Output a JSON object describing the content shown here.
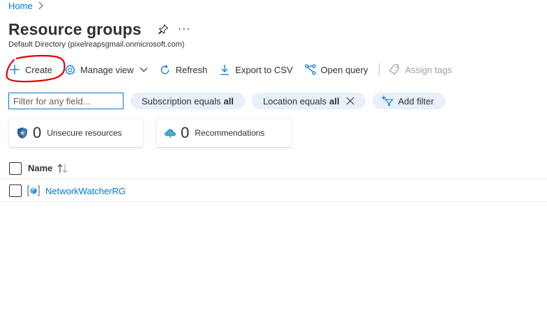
{
  "breadcrumb": {
    "home": "Home"
  },
  "header": {
    "title": "Resource groups",
    "subtitle": "Default Directory (pixelreapsgmail.onmicrosoft.com)",
    "more": "···"
  },
  "toolbar": {
    "create": "Create",
    "manage_view": "Manage view",
    "refresh": "Refresh",
    "export_csv": "Export to CSV",
    "open_query": "Open query",
    "assign_tags": "Assign tags"
  },
  "filters": {
    "placeholder": "Filter for any field...",
    "subscription_label": "Subscription equals",
    "subscription_value": "all",
    "location_label": "Location equals",
    "location_value": "all",
    "add_filter": "Add filter"
  },
  "cards": [
    {
      "count": "0",
      "label": "Unsecure resources",
      "icon": "shield-icon"
    },
    {
      "count": "0",
      "label": "Recommendations",
      "icon": "advisor-icon"
    }
  ],
  "grid": {
    "column_name": "Name",
    "rows": [
      {
        "name": "NetworkWatcherRG",
        "icon": "resource-group-icon"
      }
    ]
  },
  "colors": {
    "accent": "#0078d4",
    "pill_bg": "#e8f0fa",
    "annotation": "#e00000"
  }
}
